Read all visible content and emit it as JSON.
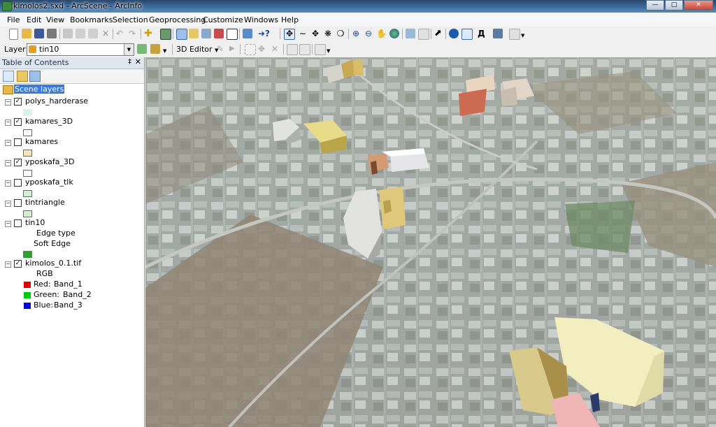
{
  "window": {
    "title": "kimolos2.sxd - ArcScene - ArcInfo"
  },
  "menu": [
    "File",
    "Edit",
    "View",
    "Bookmarks",
    "Selection",
    "Geoprocessing",
    "Customize",
    "Windows",
    "Help"
  ],
  "layer_toolbar": {
    "label": "Layer:",
    "selected": "tin10",
    "editor_label": "3D Editor"
  },
  "toc": {
    "title": "Table of Contents",
    "root": "Scene layers",
    "layers": [
      {
        "name": "polys_harderase",
        "checked": true,
        "swatch": "#d9f2ec"
      },
      {
        "name": "kamares_3D",
        "checked": true,
        "swatch": "#ffffff"
      },
      {
        "name": "kamares",
        "checked": false,
        "swatch": "#f5e6b8"
      },
      {
        "name": "yposkafa_3D",
        "checked": true,
        "swatch": "#ffffff"
      },
      {
        "name": "yposkafa_tlk",
        "checked": false,
        "swatch": "#d2f0d2"
      },
      {
        "name": "tintriangle",
        "checked": false,
        "swatch": "#d2f0d2"
      },
      {
        "name": "tin10",
        "checked": false,
        "edge_type_label": "Edge type",
        "edge_value": "Soft Edge",
        "swatch": "#2ea02e"
      },
      {
        "name": "kimolos_0.1.tif",
        "checked": true,
        "rgb_label": "RGB",
        "bands": [
          {
            "label": "Red:",
            "band": "Band_1",
            "color": "#e00000"
          },
          {
            "label": "Green:",
            "band": "Band_2",
            "color": "#00cc00"
          },
          {
            "label": "Blue:",
            "band": "Band_3",
            "color": "#0000dd"
          }
        ]
      }
    ]
  }
}
